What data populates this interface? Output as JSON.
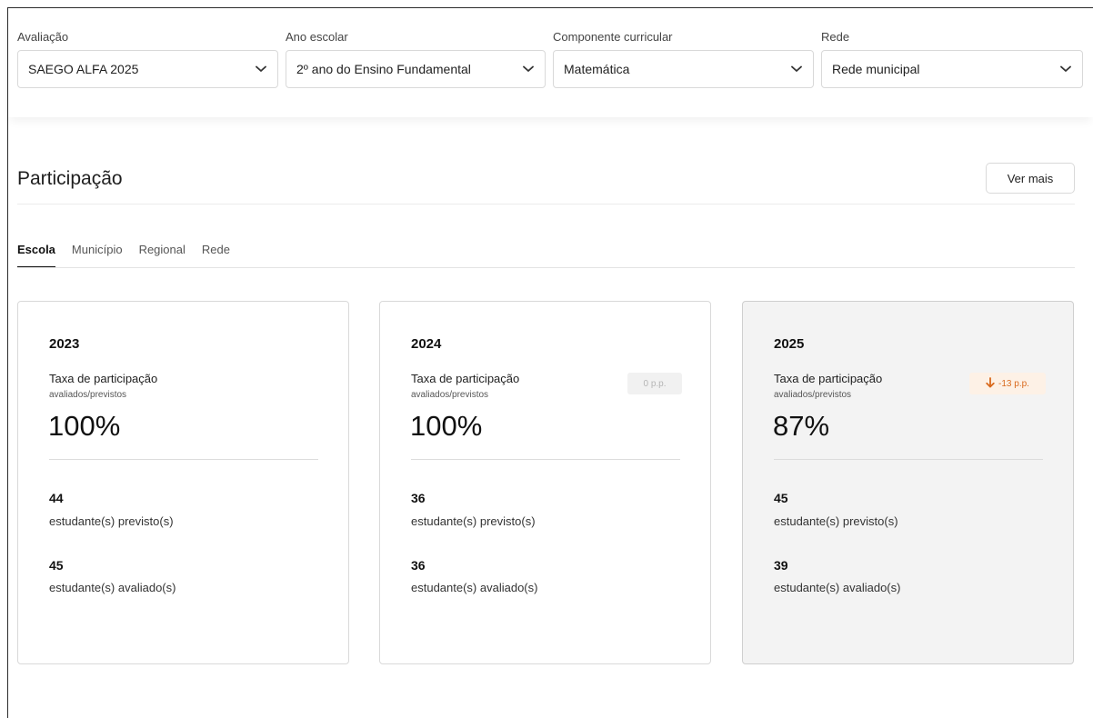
{
  "filters": [
    {
      "label": "Avaliação",
      "value": "SAEGO ALFA 2025"
    },
    {
      "label": "Ano escolar",
      "value": "2º ano do Ensino Fundamental"
    },
    {
      "label": "Componente curricular",
      "value": "Matemática"
    },
    {
      "label": "Rede",
      "value": "Rede municipal"
    }
  ],
  "section": {
    "title": "Participação",
    "ver_mais": "Ver mais"
  },
  "tabs": [
    {
      "label": "Escola",
      "active": true
    },
    {
      "label": "Município",
      "active": false
    },
    {
      "label": "Regional",
      "active": false
    },
    {
      "label": "Rede",
      "active": false
    }
  ],
  "cards": [
    {
      "year": "2023",
      "rate_label": "Taxa de participação",
      "rate_sub": "avaliados/previstos",
      "rate": "100%",
      "badge": null,
      "previstos": "44",
      "previstos_label": "estudante(s) previsto(s)",
      "avaliados": "45",
      "avaliados_label": "estudante(s) avaliado(s)"
    },
    {
      "year": "2024",
      "rate_label": "Taxa de participação",
      "rate_sub": "avaliados/previstos",
      "rate": "100%",
      "badge": "0 p.p.",
      "previstos": "36",
      "previstos_label": "estudante(s) previsto(s)",
      "avaliados": "36",
      "avaliados_label": "estudante(s) avaliado(s)"
    },
    {
      "year": "2025",
      "rate_label": "Taxa de participação",
      "rate_sub": "avaliados/previstos",
      "rate": "87%",
      "badge": "-13 p.p.",
      "previstos": "45",
      "previstos_label": "estudante(s) previsto(s)",
      "avaliados": "39",
      "avaliados_label": "estudante(s) avaliado(s)"
    }
  ],
  "colors": {
    "accent_down": "#d9691c",
    "badge_down_bg": "#fdf1e6",
    "selected_card_bg": "#f3f3f3"
  },
  "icons": {
    "dropdown": "chevron-down-icon",
    "trend": "arrow-down-icon"
  }
}
